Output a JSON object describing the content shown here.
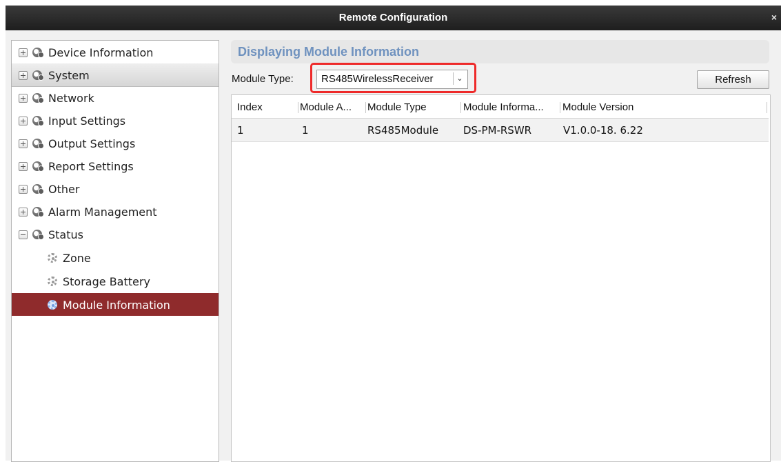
{
  "window": {
    "title": "Remote Configuration",
    "close_glyph": "×"
  },
  "sidebar": {
    "items": [
      {
        "label": "Device Information"
      },
      {
        "label": "System"
      },
      {
        "label": "Network"
      },
      {
        "label": "Input Settings"
      },
      {
        "label": "Output Settings"
      },
      {
        "label": "Report Settings"
      },
      {
        "label": "Other"
      },
      {
        "label": "Alarm Management"
      },
      {
        "label": "Status"
      }
    ],
    "status_children": [
      {
        "label": "Zone"
      },
      {
        "label": "Storage Battery"
      },
      {
        "label": "Module Information"
      }
    ],
    "selected_color": "#8f2b2c"
  },
  "panel": {
    "title": "Displaying Module Information",
    "title_color": "#6f92bf",
    "module_type_label": "Module Type:",
    "module_type_value": "RS485WirelessReceiver",
    "refresh_label": "Refresh",
    "highlight_color": "#ee2a2a"
  },
  "table": {
    "columns": [
      "Index",
      "Module A...",
      "Module Type",
      "Module Informa...",
      "Module Version"
    ],
    "rows": [
      [
        "1",
        "1",
        "RS485Module",
        "DS-PM-RSWR",
        "V1.0.0-18. 6.22"
      ]
    ]
  }
}
